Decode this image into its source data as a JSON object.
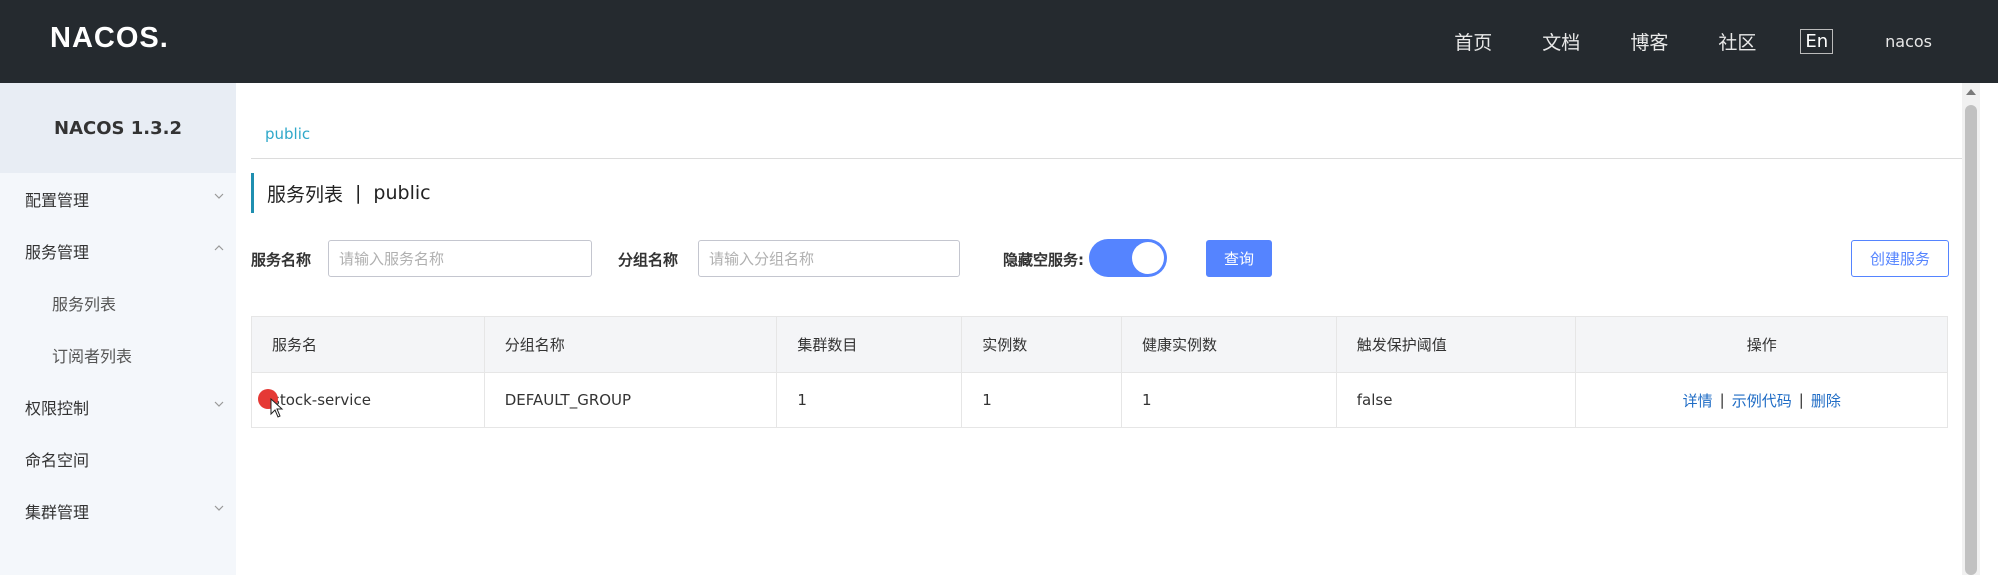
{
  "header": {
    "logo_text": "NACOS.",
    "nav": [
      "首页",
      "文档",
      "博客",
      "社区"
    ],
    "lang_button": "En",
    "user": "nacos"
  },
  "sidebar": {
    "version": "NACOS 1.3.2",
    "items": [
      {
        "label": "配置管理",
        "chevron": "chevron-down-icon"
      },
      {
        "label": "服务管理",
        "chevron": "chevron-up-icon"
      },
      {
        "label": "服务列表"
      },
      {
        "label": "订阅者列表"
      },
      {
        "label": "权限控制",
        "chevron": "chevron-down-icon"
      },
      {
        "label": "命名空间"
      },
      {
        "label": "集群管理",
        "chevron": "chevron-down-icon"
      }
    ]
  },
  "namespace": {
    "current": "public"
  },
  "page": {
    "title": "服务列表",
    "separator": "|",
    "namespace": "public"
  },
  "filters": {
    "service_name_label": "服务名称",
    "service_name_placeholder": "请输入服务名称",
    "group_name_label": "分组名称",
    "group_name_placeholder": "请输入分组名称",
    "hide_empty_label": "隐藏空服务:",
    "hide_empty_on": true,
    "query_button": "查询",
    "create_button": "创建服务"
  },
  "table": {
    "columns": [
      "服务名",
      "分组名称",
      "集群数目",
      "实例数",
      "健康实例数",
      "触发保护阈值",
      "操作"
    ],
    "rows": [
      {
        "service": "stock-service",
        "group": "DEFAULT_GROUP",
        "clusters": "1",
        "instances": "1",
        "healthy": "1",
        "threshold": "false",
        "actions": [
          "详情",
          "示例代码",
          "删除"
        ]
      }
    ]
  },
  "colors": {
    "topbar": "#252a2f",
    "accent": "#5584ff",
    "link": "#1f6cc5",
    "namespace_link": "#2fa8c9"
  }
}
